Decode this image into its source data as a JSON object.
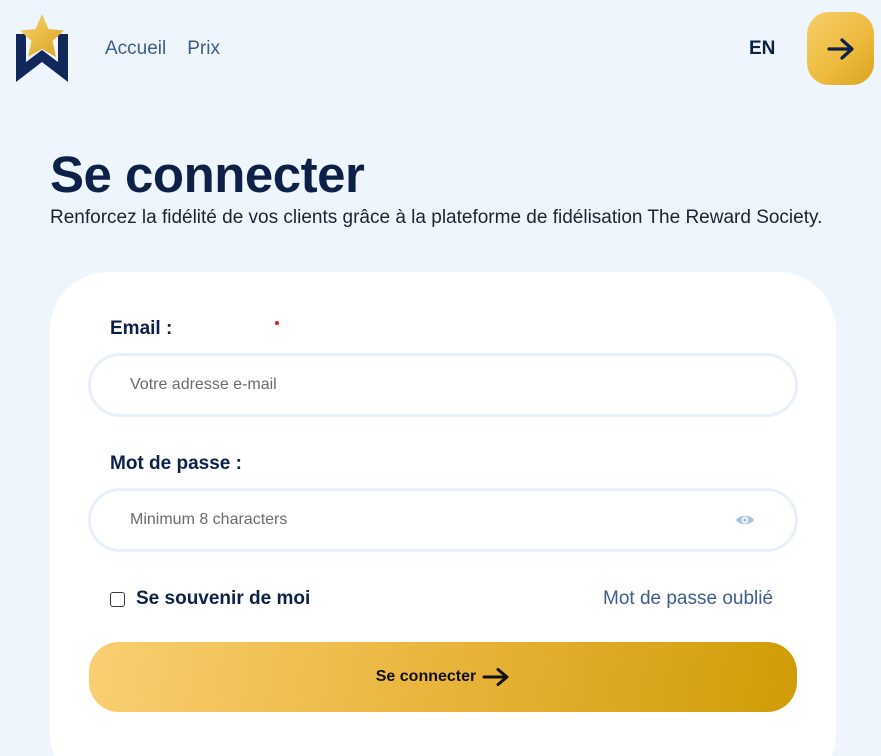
{
  "header": {
    "logo_icon": "star-badge-logo",
    "nav": [
      {
        "label": "Accueil"
      },
      {
        "label": "Prix"
      }
    ],
    "language": "EN",
    "arrow_icon": "arrow-right-icon",
    "accent_gradient": [
      "#f7cf6c",
      "#d9a420"
    ]
  },
  "main": {
    "title": "Se connecter",
    "subtitle": "Renforcez la fidélité de vos clients grâce à la plateforme de fidélisation The Reward Society."
  },
  "form": {
    "email": {
      "label": "Email :",
      "placeholder": "Votre adresse e-mail",
      "value": ""
    },
    "password": {
      "label": "Mot de passe :",
      "placeholder": "Minimum 8 characters",
      "value": "",
      "toggle_icon": "eye-icon"
    },
    "remember_label": "Se souvenir de moi",
    "remember_checked": false,
    "forgot_label": "Mot de passe oublié",
    "submit_label": "Se connecter"
  },
  "colors": {
    "background": "#eef5fd",
    "primary_text": "#0d2148",
    "link": "#3e5d8c",
    "gold": "#e9b43b",
    "required": "#d42020"
  }
}
